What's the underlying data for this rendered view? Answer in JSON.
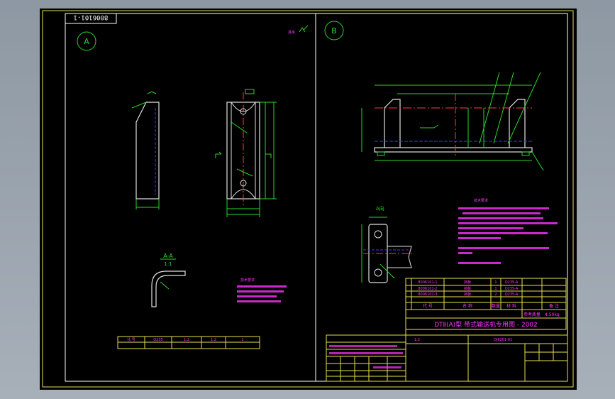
{
  "drawing": {
    "drawing_number": "8006101-1",
    "view_a_label": "A",
    "view_b_label": "B",
    "section_label": "A-A",
    "section_sub": "1:1",
    "direction_label": "A向",
    "title_line": "DTⅡ(A)型  带式输送机专用图 - 2002",
    "mass_label": "参考质量",
    "mass_value": "4.50kg",
    "table_headers": [
      "代 号",
      "名 称",
      "数量",
      "材 料",
      "备 注"
    ],
    "part_rows": [
      [
        "8006101-1",
        "挡板",
        "1",
        "Q235-A",
        ""
      ],
      [
        "8006101-2",
        "挡板",
        "1",
        "Q235-A",
        ""
      ],
      [
        "8006101-3",
        "挡板",
        "2",
        "Q235-A",
        ""
      ]
    ],
    "note_title": "技术要求",
    "bottom_row": [
      "代 号",
      "Q235",
      "1:2",
      "1:2",
      "1"
    ],
    "sheet_code": "DJ6201-01",
    "scale": "1:2"
  },
  "colors": {
    "frame": "#ffffff",
    "border": "#e8e04a",
    "outline": "#e0e0e0",
    "dim": "#28d828",
    "center": "#ff3a3a",
    "hidden": "#3a3aff",
    "text": "#ff33ff",
    "balloon": "#ffff66"
  }
}
